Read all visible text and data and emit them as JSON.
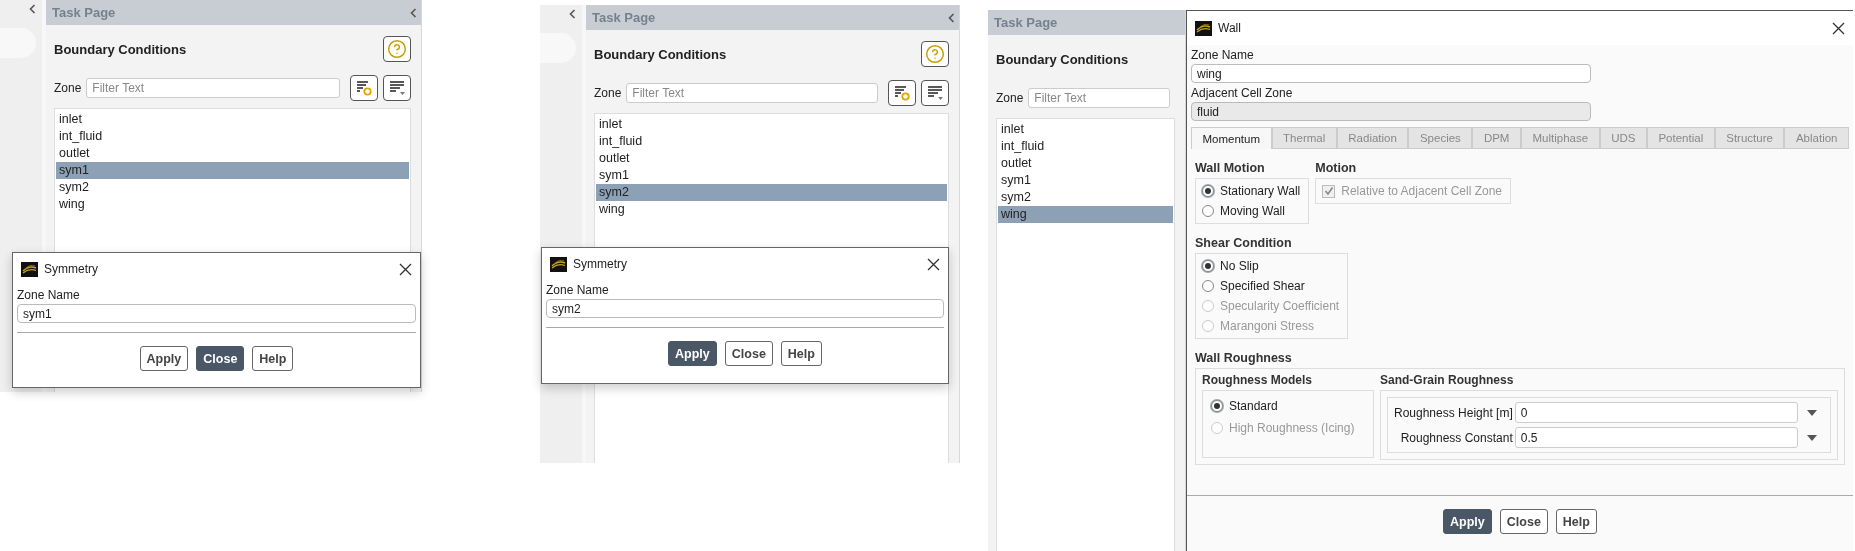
{
  "panels": [
    {
      "kind": "symmetry",
      "task_page": {
        "title": "Task Page",
        "heading": "Boundary Conditions",
        "zone_label": "Zone",
        "filter_placeholder": "Filter Text",
        "tools": true,
        "zones": [
          {
            "label": "inlet",
            "selected": false
          },
          {
            "label": "int_fluid",
            "selected": false
          },
          {
            "label": "outlet",
            "selected": false
          },
          {
            "label": "sym1",
            "selected": true
          },
          {
            "label": "sym2",
            "selected": false
          },
          {
            "label": "wing",
            "selected": false
          }
        ]
      },
      "dialog": {
        "kind": "symmetry",
        "title": "Symmetry",
        "zone_name_label": "Zone Name",
        "zone_name": "sym1",
        "buttons": [
          {
            "label": "Apply",
            "focused": false
          },
          {
            "label": "Close",
            "focused": true
          },
          {
            "label": "Help",
            "focused": false
          }
        ]
      }
    },
    {
      "kind": "symmetry",
      "task_page": {
        "title": "Task Page",
        "heading": "Boundary Conditions",
        "zone_label": "Zone",
        "filter_placeholder": "Filter Text",
        "tools": true,
        "zones": [
          {
            "label": "inlet",
            "selected": false
          },
          {
            "label": "int_fluid",
            "selected": false
          },
          {
            "label": "outlet",
            "selected": false
          },
          {
            "label": "sym1",
            "selected": false
          },
          {
            "label": "sym2",
            "selected": true
          },
          {
            "label": "wing",
            "selected": false
          }
        ]
      },
      "dialog": {
        "kind": "symmetry",
        "title": "Symmetry",
        "zone_name_label": "Zone Name",
        "zone_name": "sym2",
        "buttons": [
          {
            "label": "Apply",
            "focused": true
          },
          {
            "label": "Close",
            "focused": false
          },
          {
            "label": "Help",
            "focused": false
          }
        ]
      }
    },
    {
      "kind": "wall",
      "task_page": {
        "title": "Task Page",
        "heading": "Boundary Conditions",
        "zone_label": "Zone",
        "filter_placeholder": "Filter Text",
        "tools": false,
        "zones": [
          {
            "label": "inlet",
            "selected": false
          },
          {
            "label": "int_fluid",
            "selected": false
          },
          {
            "label": "outlet",
            "selected": false
          },
          {
            "label": "sym1",
            "selected": false
          },
          {
            "label": "sym2",
            "selected": false
          },
          {
            "label": "wing",
            "selected": true
          }
        ]
      },
      "dialog": {
        "kind": "wall",
        "title": "Wall",
        "zone_name_label": "Zone Name",
        "zone_name": "wing",
        "adjacent_label": "Adjacent Cell Zone",
        "adjacent_zone": "fluid",
        "tabs": [
          {
            "label": "Momentum",
            "selected": true
          },
          {
            "label": "Thermal",
            "selected": false
          },
          {
            "label": "Radiation",
            "selected": false
          },
          {
            "label": "Species",
            "selected": false
          },
          {
            "label": "DPM",
            "selected": false
          },
          {
            "label": "Multiphase",
            "selected": false
          },
          {
            "label": "UDS",
            "selected": false
          },
          {
            "label": "Potential",
            "selected": false
          },
          {
            "label": "Structure",
            "selected": false
          },
          {
            "label": "Ablation",
            "selected": false
          }
        ],
        "wall_motion": {
          "title": "Wall Motion",
          "options": [
            {
              "label": "Stationary Wall",
              "selected": true,
              "disabled": false
            },
            {
              "label": "Moving Wall",
              "selected": false,
              "disabled": false
            }
          ]
        },
        "motion": {
          "title": "Motion",
          "checkbox": {
            "label": "Relative to Adjacent Cell Zone",
            "checked": true,
            "disabled": true
          }
        },
        "shear_condition": {
          "title": "Shear Condition",
          "options": [
            {
              "label": "No Slip",
              "selected": true,
              "disabled": false
            },
            {
              "label": "Specified Shear",
              "selected": false,
              "disabled": false
            },
            {
              "label": "Specularity Coefficient",
              "selected": false,
              "disabled": true
            },
            {
              "label": "Marangoni Stress",
              "selected": false,
              "disabled": true
            }
          ]
        },
        "wall_roughness": {
          "title": "Wall Roughness",
          "models": {
            "title": "Roughness Models",
            "options": [
              {
                "label": "Standard",
                "selected": true,
                "disabled": false
              },
              {
                "label": "High Roughness (Icing)",
                "selected": false,
                "disabled": true
              }
            ]
          },
          "sand_grain": {
            "title": "Sand-Grain Roughness",
            "fields": [
              {
                "label": "Roughness Height [m]",
                "value": "0"
              },
              {
                "label": "Roughness Constant",
                "value": "0.5"
              }
            ]
          }
        },
        "buttons": [
          {
            "label": "Apply",
            "focused": true
          },
          {
            "label": "Close",
            "focused": false
          },
          {
            "label": "Help",
            "focused": false
          }
        ]
      }
    }
  ]
}
